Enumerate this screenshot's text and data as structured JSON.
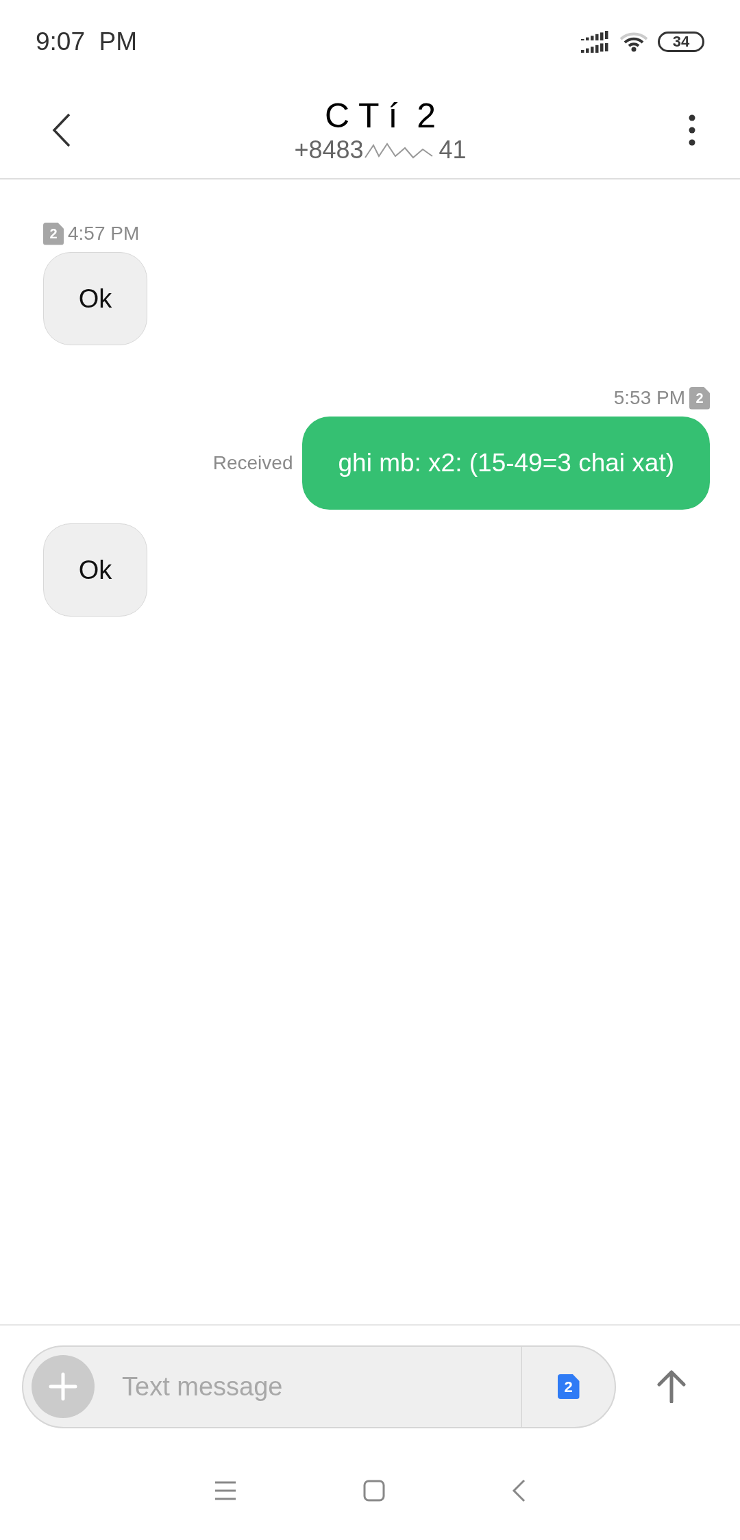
{
  "status_bar": {
    "time": "9:07  PM",
    "battery": "34"
  },
  "header": {
    "title": "C T í  2",
    "phone_start": "+8483",
    "phone_end": "41"
  },
  "messages": [
    {
      "kind": "incoming",
      "sim": "2",
      "time": "4:57 PM",
      "text": "Ok"
    },
    {
      "kind": "outgoing",
      "sim": "2",
      "time": "5:53 PM",
      "status": "Received",
      "text": "ghi mb: x2: (15-49=3 chai xat)"
    },
    {
      "kind": "incoming",
      "text": "Ok"
    }
  ],
  "composer": {
    "placeholder": "Text message",
    "sim": "2"
  }
}
